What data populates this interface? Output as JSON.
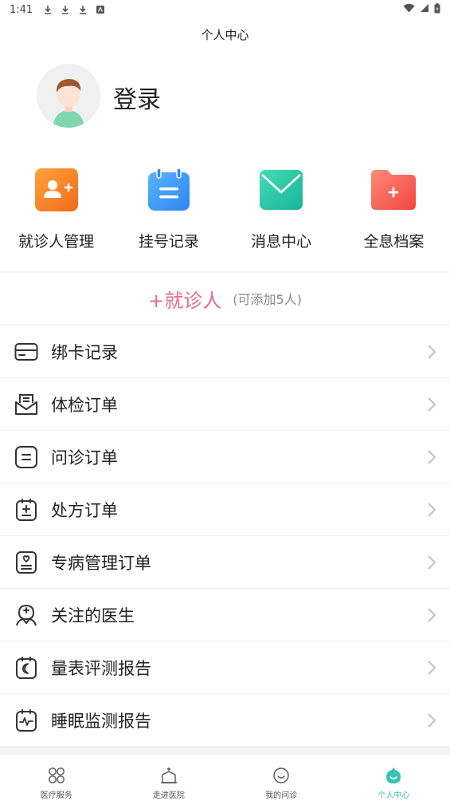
{
  "status_bar": {
    "time": "1:41"
  },
  "header": {
    "title": "个人中心"
  },
  "profile": {
    "login_label": "登录"
  },
  "quick_actions": [
    {
      "label": "就诊人管理",
      "icon": "add-person-icon",
      "color": "#f7892b"
    },
    {
      "label": "挂号记录",
      "icon": "calendar-icon",
      "color": "#3d9bf5"
    },
    {
      "label": "消息中心",
      "icon": "mail-icon",
      "color": "#2ec6a4"
    },
    {
      "label": "全息档案",
      "icon": "folder-plus-icon",
      "color": "#f4615d"
    }
  ],
  "add_patient": {
    "label": "+就诊人",
    "hint": "(可添加5人)"
  },
  "menu": [
    {
      "label": "绑卡记录",
      "icon": "card-icon"
    },
    {
      "label": "体检订单",
      "icon": "exam-envelope-icon"
    },
    {
      "label": "问诊订单",
      "icon": "consult-icon"
    },
    {
      "label": "处方订单",
      "icon": "prescription-icon"
    },
    {
      "label": "专病管理订单",
      "icon": "heart-clipboard-icon"
    },
    {
      "label": "关注的医生",
      "icon": "doctor-icon"
    },
    {
      "label": "量表评测报告",
      "icon": "moon-calendar-icon"
    },
    {
      "label": "睡眠监测报告",
      "icon": "pulse-calendar-icon"
    }
  ],
  "tabbar": [
    {
      "label": "医疗服务",
      "icon": "grid-circles-icon",
      "active": false
    },
    {
      "label": "走进医院",
      "icon": "hospital-icon",
      "active": false
    },
    {
      "label": "我的问诊",
      "icon": "smiley-icon",
      "active": false
    },
    {
      "label": "个人中心",
      "icon": "person-center-icon",
      "active": true
    }
  ],
  "colors": {
    "accent": "#37c3b0",
    "add_patient": "#e86b8c"
  }
}
